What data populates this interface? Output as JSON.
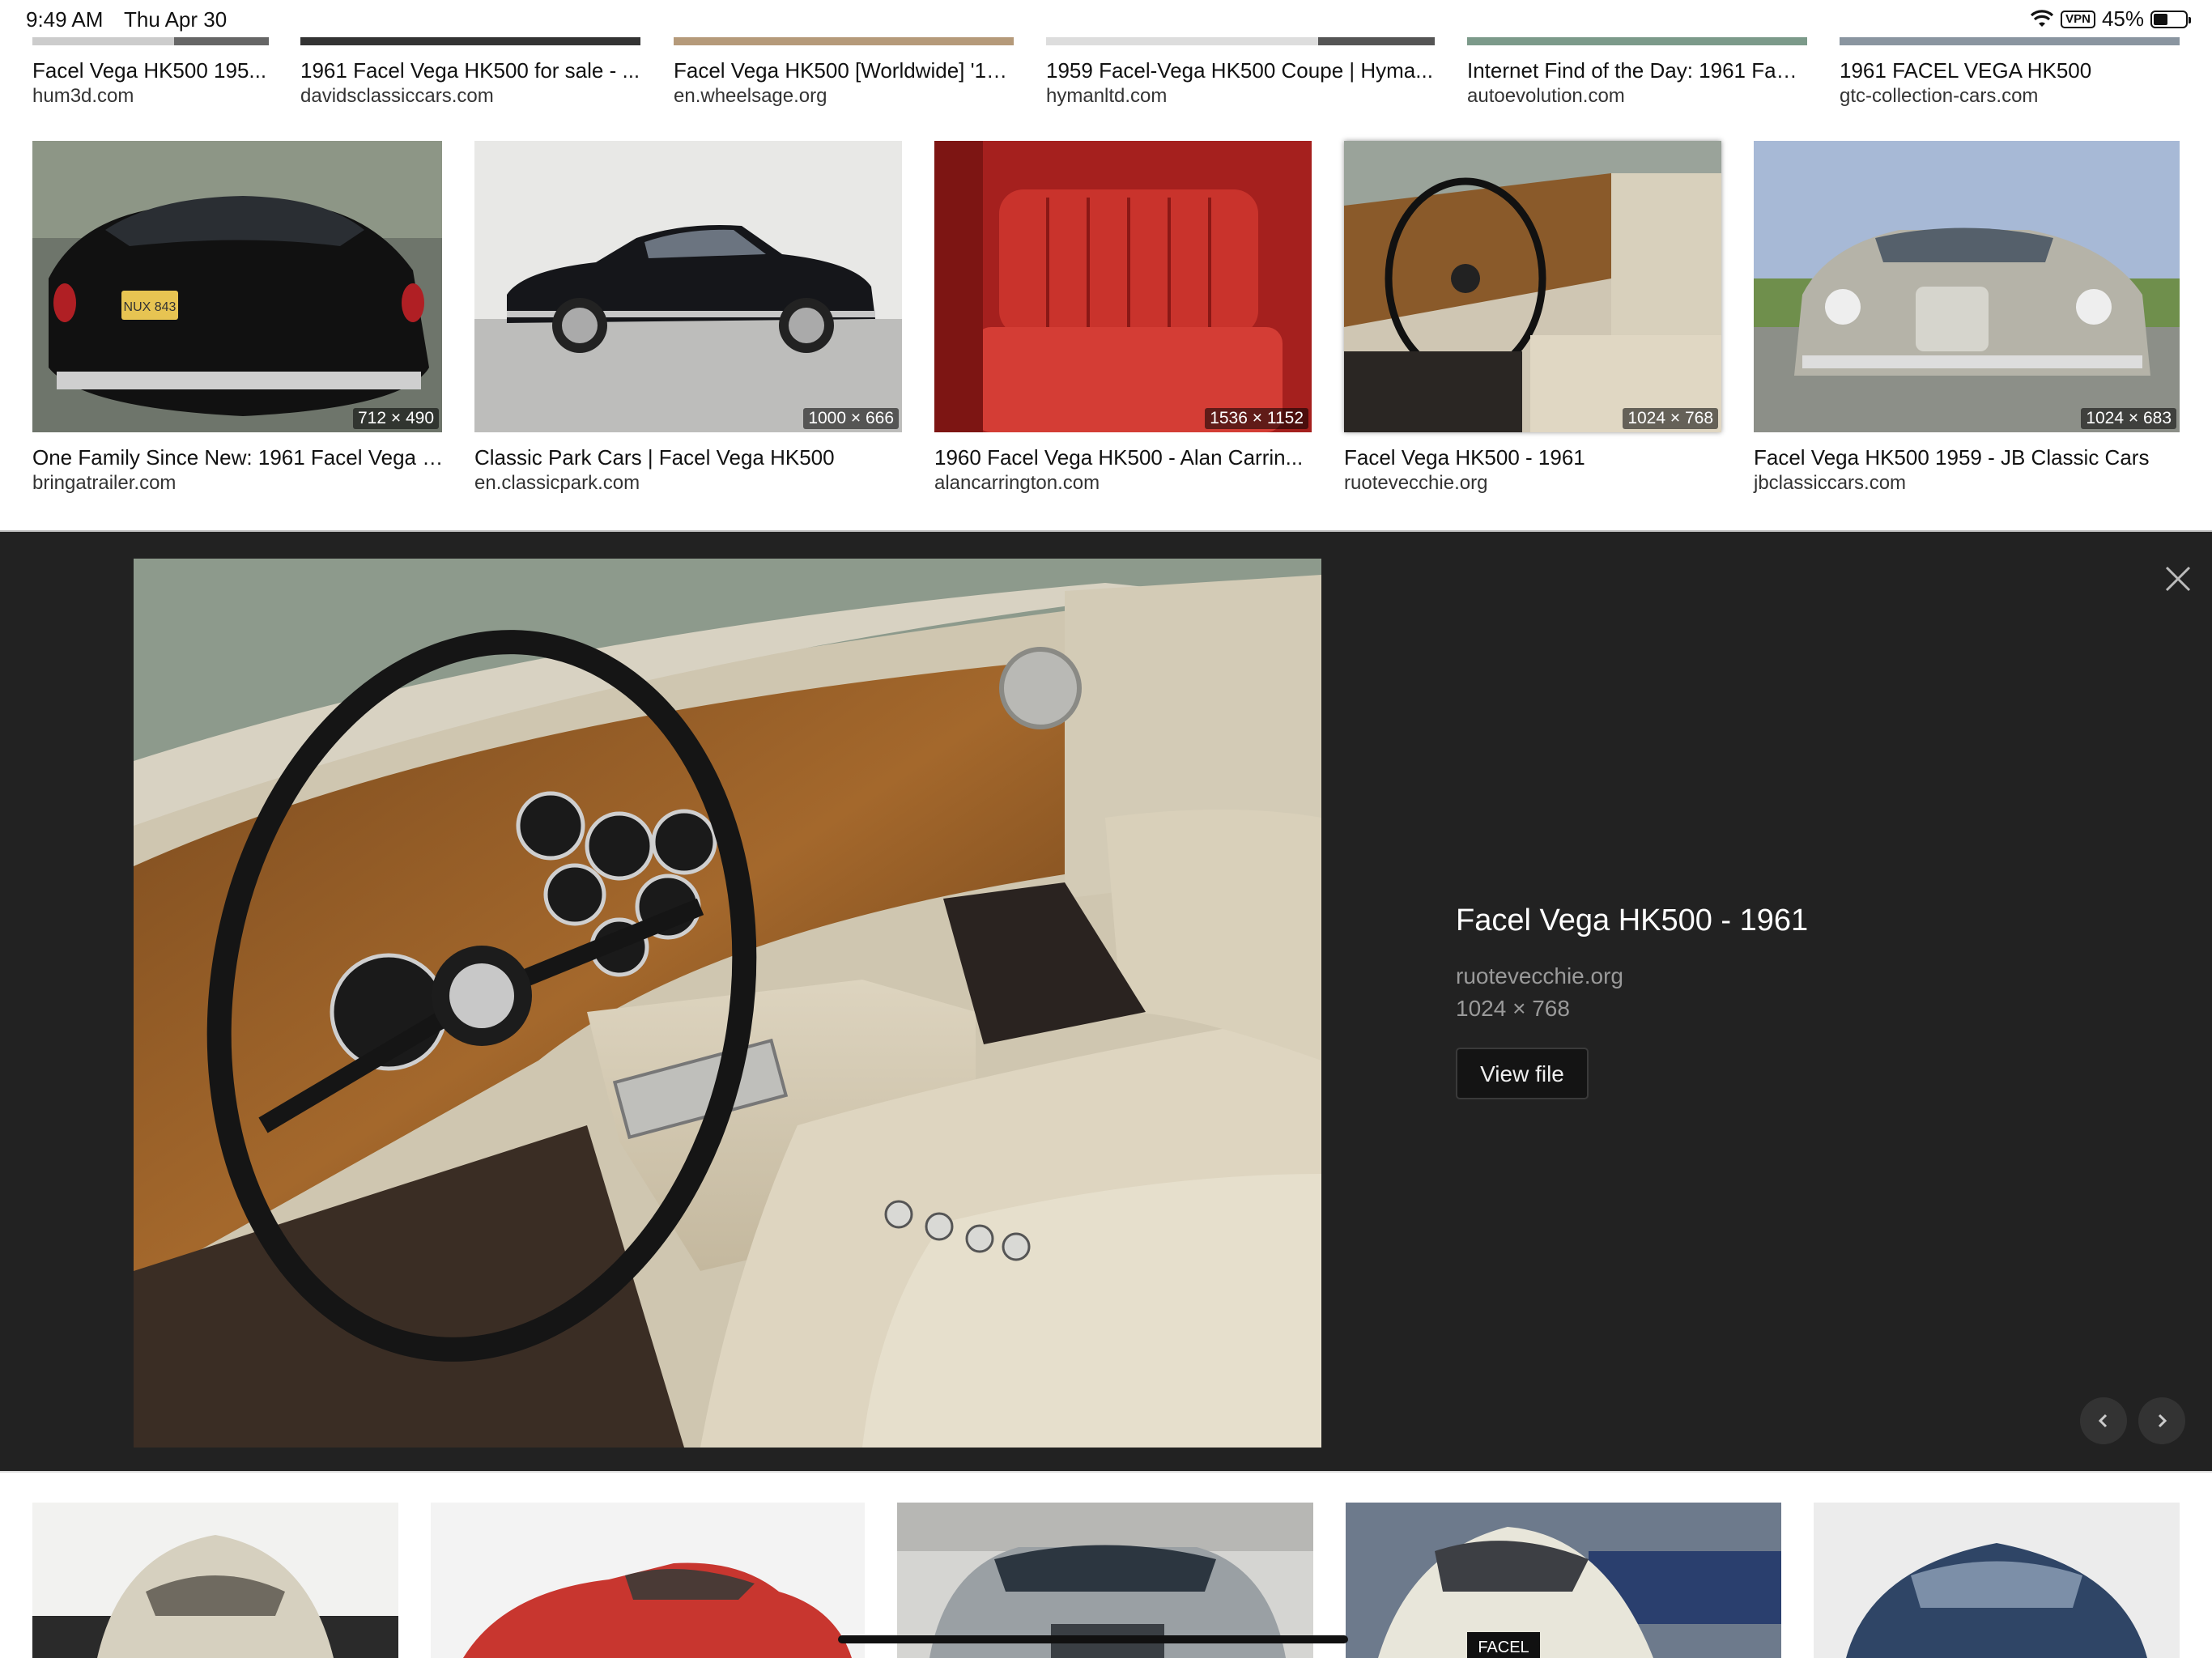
{
  "status_bar": {
    "time": "9:49 AM",
    "date": "Thu Apr 30",
    "vpn": "VPN",
    "battery_pct": "45%",
    "battery_level": 0.45
  },
  "top_row": [
    {
      "title": "Facel Vega HK500 195...",
      "site": "hum3d.com"
    },
    {
      "title": "1961 Facel Vega HK500 for sale - ...",
      "site": "davidsclassiccars.com"
    },
    {
      "title": "Facel Vega HK500 [Worldwide] '19...",
      "site": "en.wheelsage.org"
    },
    {
      "title": "1959 Facel-Vega HK500 Coupe | Hyma...",
      "site": "hymanltd.com"
    },
    {
      "title": "Internet Find of the Day: 1961 Face...",
      "site": "autoevolution.com"
    },
    {
      "title": "1961 FACEL VEGA HK500",
      "site": "gtc-collection-cars.com"
    }
  ],
  "middle_row": [
    {
      "title": "One Family Since New: 1961 Facel Vega H...",
      "site": "bringatrailer.com",
      "dims": "712 × 490"
    },
    {
      "title": "Classic Park Cars | Facel Vega HK500",
      "site": "en.classicpark.com",
      "dims": "1000 × 666"
    },
    {
      "title": "1960 Facel Vega HK500 - Alan Carrin...",
      "site": "alancarrington.com",
      "dims": "1536 × 1152"
    },
    {
      "title": "Facel Vega HK500 - 1961",
      "site": "ruotevecchie.org",
      "dims": "1024 × 768"
    },
    {
      "title": "Facel Vega HK500 1959 - JB Classic Cars",
      "site": "jbclassiccars.com",
      "dims": "1024 × 683"
    }
  ],
  "viewer": {
    "title": "Facel Vega HK500 - 1961",
    "site": "ruotevecchie.org",
    "dims": "1024 × 768",
    "view_file_label": "View file"
  },
  "image_text": {
    "plate": "NUX 843",
    "facel_plate": "FACEL"
  },
  "icons": {
    "close": "close-icon",
    "prev": "chevron-left-icon",
    "next": "chevron-right-icon",
    "wifi": "wifi-icon",
    "battery": "battery-icon"
  }
}
